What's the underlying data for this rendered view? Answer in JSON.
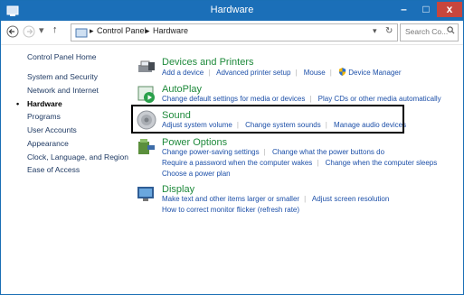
{
  "window": {
    "title": "Hardware"
  },
  "titlebar": {
    "minimize": "–",
    "maximize": "□",
    "close": "x"
  },
  "nav": {
    "back": "←",
    "forward": "→",
    "up": "↑",
    "dropdown": "▾"
  },
  "address": {
    "crumbs": [
      "Control Panel",
      "Hardware"
    ],
    "separator": "▸",
    "dropdown": "▾",
    "refresh": "↻"
  },
  "search": {
    "placeholder": "Search Co...",
    "icon": "search-icon"
  },
  "sidebar": {
    "items": [
      {
        "label": "Control Panel Home"
      },
      {
        "label": "System and Security"
      },
      {
        "label": "Network and Internet"
      },
      {
        "label": "Hardware"
      },
      {
        "label": "Programs"
      },
      {
        "label": "User Accounts"
      },
      {
        "label": "Appearance"
      },
      {
        "label": "Clock, Language, and Region"
      },
      {
        "label": "Ease of Access"
      }
    ],
    "current_marker": "•"
  },
  "categories": [
    {
      "title": "Devices and Printers",
      "icon": "printer-icon",
      "rows": [
        [
          "Add a device",
          "Advanced printer setup",
          "Mouse",
          "Device Manager"
        ]
      ]
    },
    {
      "title": "AutoPlay",
      "icon": "autoplay-icon",
      "rows": [
        [
          "Change default settings for media or devices",
          "Play CDs or other media automatically"
        ]
      ]
    },
    {
      "title": "Sound",
      "icon": "speaker-icon",
      "rows": [
        [
          "Adjust system volume",
          "Change system sounds",
          "Manage audio devices"
        ]
      ]
    },
    {
      "title": "Power Options",
      "icon": "power-icon",
      "rows": [
        [
          "Change power-saving settings",
          "Change what the power buttons do"
        ],
        [
          "Require a password when the computer wakes",
          "Change when the computer sleeps"
        ],
        [
          "Choose a power plan"
        ]
      ]
    },
    {
      "title": "Display",
      "icon": "monitor-icon",
      "rows": [
        [
          "Make text and other items larger or smaller",
          "Adjust screen resolution"
        ],
        [
          "How to correct monitor flicker (refresh rate)"
        ]
      ]
    }
  ],
  "colors": {
    "titlebar": "#1b6fb8",
    "category_title": "#1f8a3c",
    "link": "#1c4fa8",
    "close": "#c7463d"
  }
}
